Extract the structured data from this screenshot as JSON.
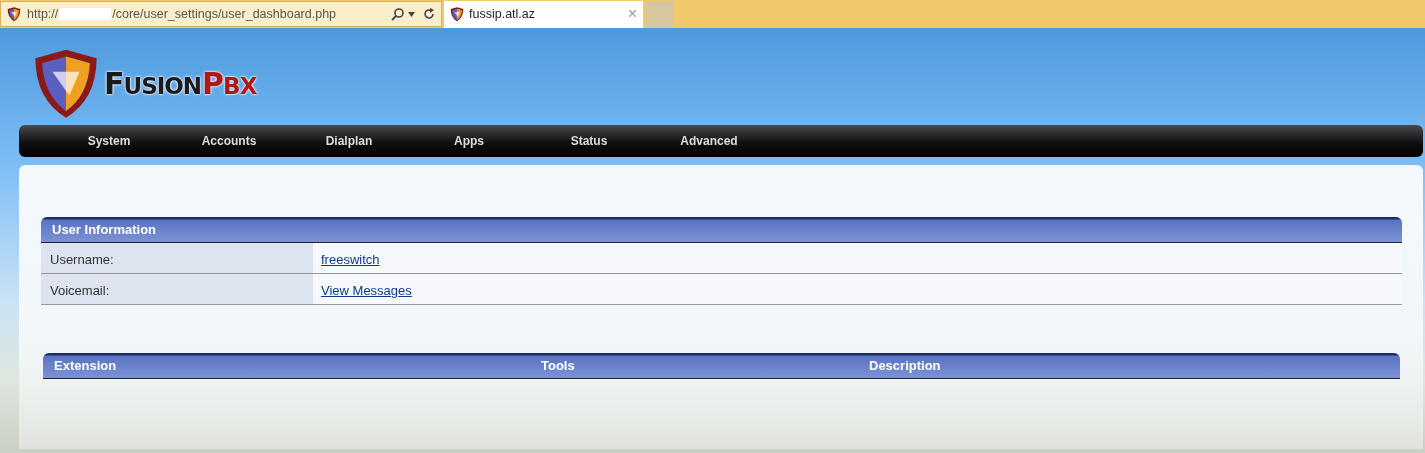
{
  "browser": {
    "address": {
      "scheme": "http://",
      "path": "/core/user_settings/user_dashboard.php"
    },
    "tabs": [
      {
        "title": "fussip.atl.az",
        "close": "×",
        "selected": true
      }
    ]
  },
  "logo": {
    "words": [
      "FUSION",
      "PBX"
    ]
  },
  "menu": [
    {
      "label": "System"
    },
    {
      "label": "Accounts"
    },
    {
      "label": "Dialplan"
    },
    {
      "label": "Apps"
    },
    {
      "label": "Status"
    },
    {
      "label": "Advanced"
    }
  ],
  "user_information": {
    "title": "User Information",
    "rows": [
      {
        "label": "Username:",
        "value": "freeswitch"
      },
      {
        "label": "Voicemail:",
        "value": "View Messages"
      }
    ]
  },
  "extensions_table": {
    "columns": [
      "Extension",
      "Tools",
      "Description"
    ]
  }
}
